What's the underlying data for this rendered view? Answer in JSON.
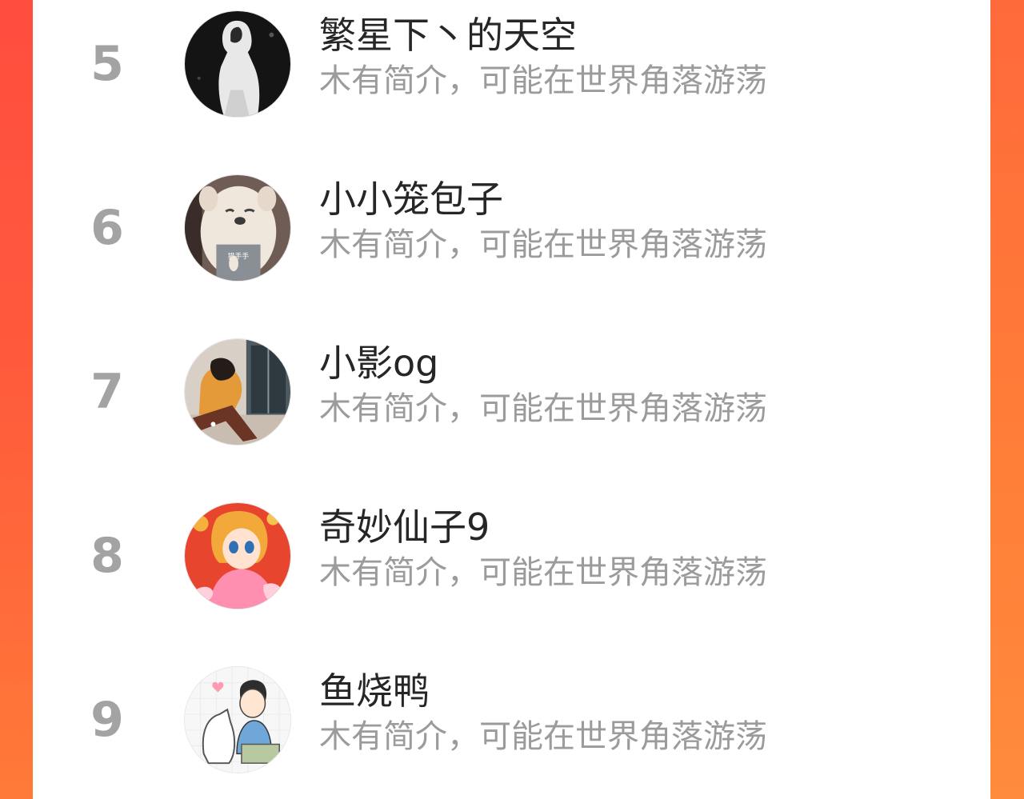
{
  "colors": {
    "accent_left": "#ff4d3f",
    "accent_right": "#ff7f38",
    "rank_gray": "#a3a3a3",
    "name_text": "#262626",
    "bio_text": "#9b9b9b"
  },
  "ranking": {
    "items": [
      {
        "rank": "5",
        "name": "繁星下丶的天空",
        "bio": "木有简介，可能在世界角落游荡",
        "avatar_icon": "hooded-figure-avatar"
      },
      {
        "rank": "6",
        "name": "小小笼包子",
        "bio": "木有简介，可能在世界角落游荡",
        "avatar_icon": "white-dog-avatar"
      },
      {
        "rank": "7",
        "name": "小影og",
        "bio": "木有简介，可能在世界角落游荡",
        "avatar_icon": "sitting-girl-avatar"
      },
      {
        "rank": "8",
        "name": "奇妙仙子9",
        "bio": "木有简介，可能在世界角落游荡",
        "avatar_icon": "cartoon-princess-avatar"
      },
      {
        "rank": "9",
        "name": "鱼烧鸭",
        "bio": "木有简介，可能在世界角落游荡",
        "avatar_icon": "cartoon-boy-dog-avatar"
      }
    ]
  }
}
